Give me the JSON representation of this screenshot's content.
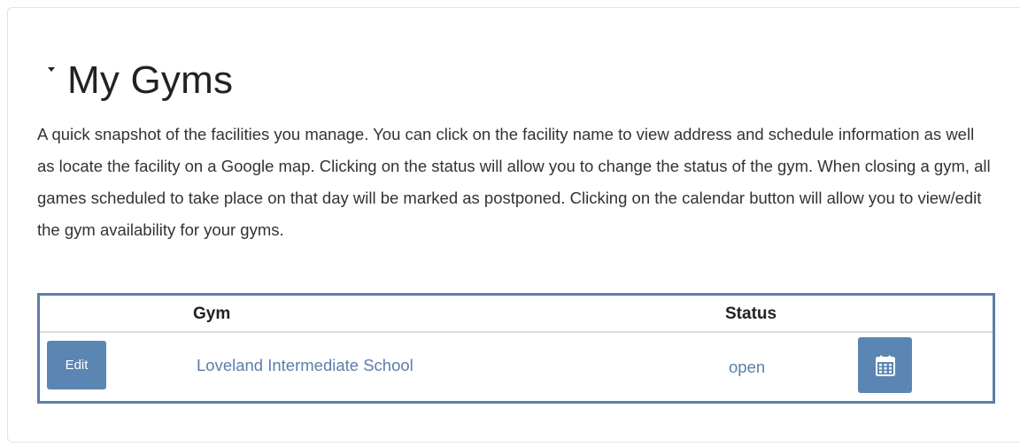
{
  "section": {
    "title": "My Gyms",
    "description": "A quick snapshot of the facilities you manage. You can click on the facility name to view address and schedule information as well as locate the facility on a Google map. Clicking on the status will allow you to change the status of the gym. When closing a gym, all games scheduled to take place on that day will be marked as postponed. Clicking on the calendar button will allow you to view/edit the gym availability for your gyms."
  },
  "table": {
    "headers": {
      "gym": "Gym",
      "status": "Status"
    },
    "rows": [
      {
        "edit_label": "Edit",
        "gym_name": "Loveland Intermediate School",
        "status": "open",
        "calendar_icon": "calendar-icon"
      }
    ]
  },
  "colors": {
    "accent": "#5b86b3",
    "link": "#5b7fa8",
    "table_border": "#5b7fa8"
  }
}
